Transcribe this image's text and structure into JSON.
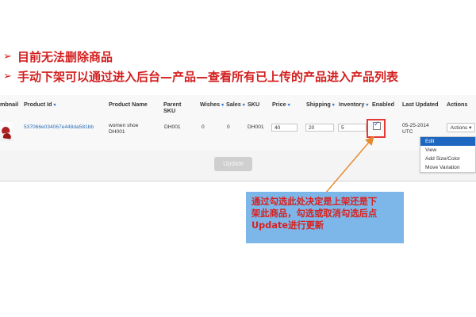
{
  "bullets": [
    {
      "text": "目前无法删除商品"
    },
    {
      "text": "手动下架可以通过进入后台—产品—查看所有已上传的产品进入产品列表"
    }
  ],
  "table": {
    "headers": {
      "thumbnail": "mbnail",
      "product_id": "Product Id",
      "product_name": "Product Name",
      "parent_sku_line1": "Parent",
      "parent_sku_line2": "SKU",
      "wishes": "Wishes",
      "sales": "Sales",
      "sku": "SKU",
      "price": "Price",
      "shipping": "Shipping",
      "inventory": "Inventory",
      "enabled": "Enabled",
      "last_updated": "Last Updated",
      "actions": "Actions"
    },
    "row": {
      "product_id": "537066e034067e448da581bb",
      "product_name_line1": "women shoe",
      "product_name_line2": "DH001",
      "parent_sku": "DH001",
      "wishes": "0",
      "sales": "0",
      "sku": "DH001",
      "price": "40",
      "shipping": "20",
      "inventory": "5",
      "last_updated_line1": "05-25-2014",
      "last_updated_line2": "UTC",
      "actions_label": "Actions ▾"
    }
  },
  "actions_menu": [
    {
      "label": "Edit"
    },
    {
      "label": "View"
    },
    {
      "label": "Add Size/Color"
    },
    {
      "label": "Move Variation"
    }
  ],
  "update_button": "Update",
  "callout": {
    "line1": "通过勾选此处决定是上架还是下",
    "line2": "架此商品，勾选或取消勾选后点",
    "line3": "Update进行更新"
  },
  "colors": {
    "accent_red": "#d31f1f",
    "callout_bg": "#7db6e8",
    "arrow": "#e58a2d",
    "link": "#2a6fb8",
    "menu_active": "#1d67c0"
  }
}
